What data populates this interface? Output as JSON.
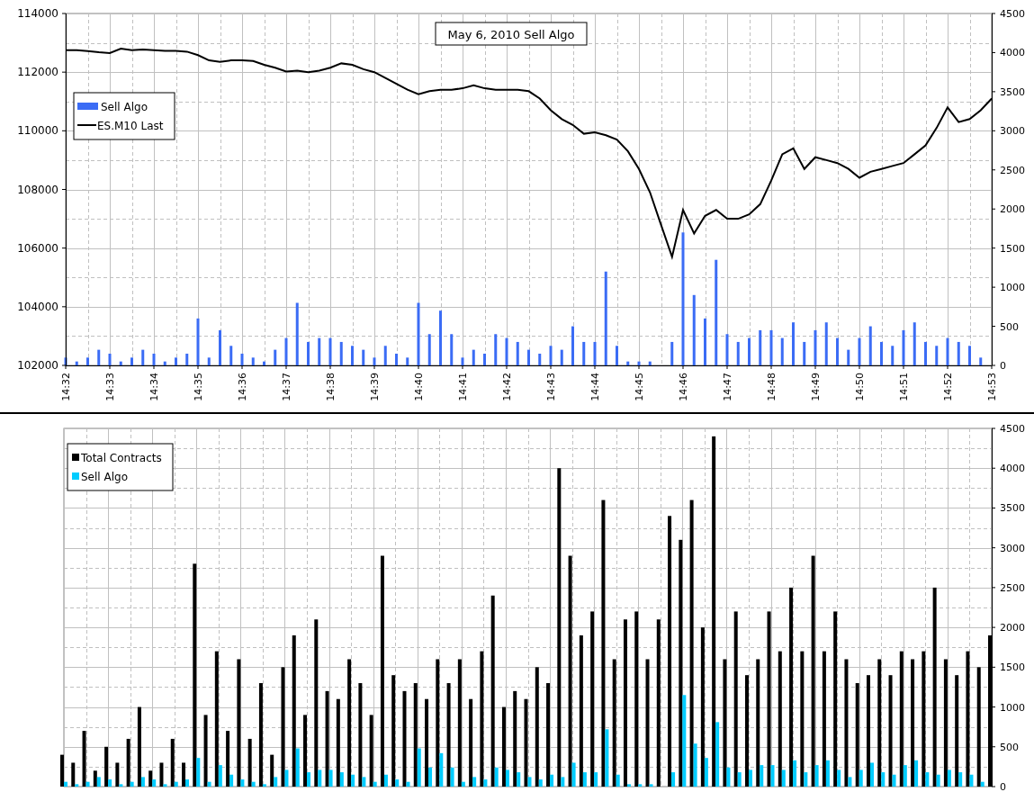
{
  "top_panel": {
    "chart_data": {
      "type": "line",
      "title": "May 6, 2010 Sell Algo",
      "categories": [
        "14:32",
        null,
        null,
        null,
        "14:33",
        null,
        null,
        null,
        "14:34",
        null,
        null,
        null,
        "14:35",
        null,
        null,
        null,
        "14:36",
        null,
        null,
        null,
        "14:37",
        null,
        null,
        null,
        "14:38",
        null,
        null,
        null,
        "14:39",
        null,
        null,
        null,
        "14:40",
        null,
        null,
        null,
        "14:41",
        null,
        null,
        null,
        "14:42",
        null,
        null,
        null,
        "14:43",
        null,
        null,
        null,
        "14:44",
        null,
        null,
        null,
        "14:45",
        null,
        null,
        null,
        "14:46",
        null,
        null,
        null,
        "14:47",
        null,
        null,
        null,
        "14:48",
        null,
        null,
        null,
        "14:49",
        null,
        null,
        null,
        "14:50",
        null,
        null,
        null,
        "14:51",
        null,
        null,
        null,
        "14:52",
        null,
        null,
        null,
        "14:53"
      ],
      "series": [
        {
          "name": "Sell Algo",
          "color": "#3b6cf5",
          "type": "bar",
          "axis": "y2",
          "values": [
            100,
            50,
            100,
            200,
            150,
            50,
            100,
            200,
            150,
            50,
            100,
            150,
            600,
            100,
            450,
            250,
            150,
            100,
            50,
            200,
            350,
            800,
            300,
            350,
            350,
            300,
            250,
            200,
            100,
            250,
            150,
            100,
            800,
            400,
            700,
            400,
            100,
            200,
            150,
            400,
            350,
            300,
            200,
            150,
            250,
            200,
            500,
            300,
            300,
            1200,
            250,
            50,
            50,
            50,
            0,
            300,
            1700,
            900,
            600,
            1350,
            400,
            300,
            350,
            450,
            450,
            350,
            550,
            300,
            450,
            550,
            350,
            200,
            350,
            500,
            300,
            250,
            450,
            550,
            300,
            250,
            350,
            300,
            250,
            100,
            0
          ]
        },
        {
          "name": "ES.M10 Last",
          "color": "#000000",
          "values": [
            112750,
            112750,
            112720,
            112680,
            112650,
            112800,
            112750,
            112770,
            112750,
            112730,
            112730,
            112700,
            112580,
            112400,
            112350,
            112400,
            112400,
            112380,
            112250,
            112150,
            112020,
            112050,
            112000,
            112050,
            112150,
            112300,
            112250,
            112100,
            112000,
            111800,
            111600,
            111400,
            111250,
            111350,
            111400,
            111400,
            111450,
            111550,
            111450,
            111400,
            111400,
            111400,
            111350,
            111100,
            110700,
            110400,
            110200,
            109900,
            109950,
            109850,
            109700,
            109300,
            108700,
            107900,
            106800,
            105700,
            107300,
            106500,
            107100,
            107300,
            107000,
            107000,
            107150,
            107500,
            108300,
            109200,
            109400,
            108700,
            109100,
            109000,
            108900,
            108700,
            108400,
            108600,
            108700,
            108800,
            108900,
            109200,
            109500,
            110100,
            110800,
            110300,
            110400,
            110700,
            111100
          ]
        }
      ],
      "ylim": [
        102000,
        114000
      ],
      "yticks": [
        102000,
        104000,
        106000,
        108000,
        110000,
        112000,
        114000
      ],
      "y2lim": [
        0,
        4500
      ],
      "y2ticks": [
        0,
        500,
        1000,
        1500,
        2000,
        2500,
        3000,
        3500,
        4000,
        4500
      ],
      "grid": true,
      "legend": true
    }
  },
  "bottom_panel": {
    "chart_data": {
      "type": "bar",
      "categories": [
        null,
        null,
        null,
        null,
        null,
        null,
        null,
        null,
        null,
        null,
        null,
        null,
        null,
        null,
        null,
        null,
        null,
        null,
        null,
        null,
        null,
        null,
        null,
        null,
        null,
        null,
        null,
        null,
        null,
        null,
        null,
        null,
        null,
        null,
        null,
        null,
        null,
        null,
        null,
        null,
        null,
        null,
        null,
        null,
        null,
        null,
        null,
        null,
        null,
        null,
        null,
        null,
        null,
        null,
        null,
        null,
        null,
        null,
        null,
        null,
        null,
        null,
        null,
        null,
        null,
        null,
        null,
        null,
        null,
        null,
        null,
        null,
        null,
        null,
        null,
        null,
        null,
        null,
        null,
        null,
        null,
        null,
        null,
        null,
        null
      ],
      "series": [
        {
          "name": "Total Contracts",
          "color": "#000000",
          "values": [
            400,
            300,
            700,
            200,
            500,
            300,
            600,
            1000,
            200,
            300,
            600,
            300,
            2800,
            900,
            1700,
            700,
            1600,
            600,
            1300,
            400,
            1500,
            1900,
            900,
            2100,
            1200,
            1100,
            1600,
            1300,
            900,
            2900,
            1400,
            1200,
            1300,
            1100,
            1600,
            1300,
            1600,
            1100,
            1700,
            2400,
            1000,
            1200,
            1100,
            1500,
            1300,
            4000,
            2900,
            1900,
            2200,
            3600,
            1600,
            2100,
            2200,
            1600,
            2100,
            3400,
            3100,
            3600,
            2000,
            4400,
            1600,
            2200,
            1400,
            1600,
            2200,
            1700,
            2500,
            1700,
            2900,
            1700,
            2200,
            1600,
            1300,
            1400,
            1600,
            1400,
            1700,
            1600,
            1700,
            2500,
            1600,
            1400,
            1700,
            1500,
            1900
          ]
        },
        {
          "name": "Sell Algo",
          "color": "#00ccff",
          "values": [
            60,
            30,
            60,
            120,
            90,
            30,
            60,
            120,
            90,
            30,
            60,
            90,
            360,
            60,
            270,
            150,
            90,
            60,
            30,
            120,
            210,
            480,
            180,
            210,
            210,
            180,
            150,
            120,
            60,
            150,
            90,
            60,
            480,
            240,
            420,
            240,
            60,
            120,
            90,
            240,
            210,
            180,
            120,
            90,
            150,
            120,
            300,
            180,
            180,
            720,
            150,
            30,
            30,
            30,
            0,
            180,
            1150,
            540,
            360,
            810,
            240,
            180,
            210,
            270,
            270,
            210,
            330,
            180,
            270,
            330,
            210,
            120,
            210,
            300,
            180,
            150,
            270,
            330,
            180,
            150,
            210,
            180,
            150,
            60,
            0
          ]
        }
      ],
      "ylim": [
        0,
        4500
      ],
      "yticks": [
        0,
        500,
        1000,
        1500,
        2000,
        2500,
        3000,
        3500,
        4000,
        4500
      ],
      "grid": true,
      "legend": true
    }
  }
}
